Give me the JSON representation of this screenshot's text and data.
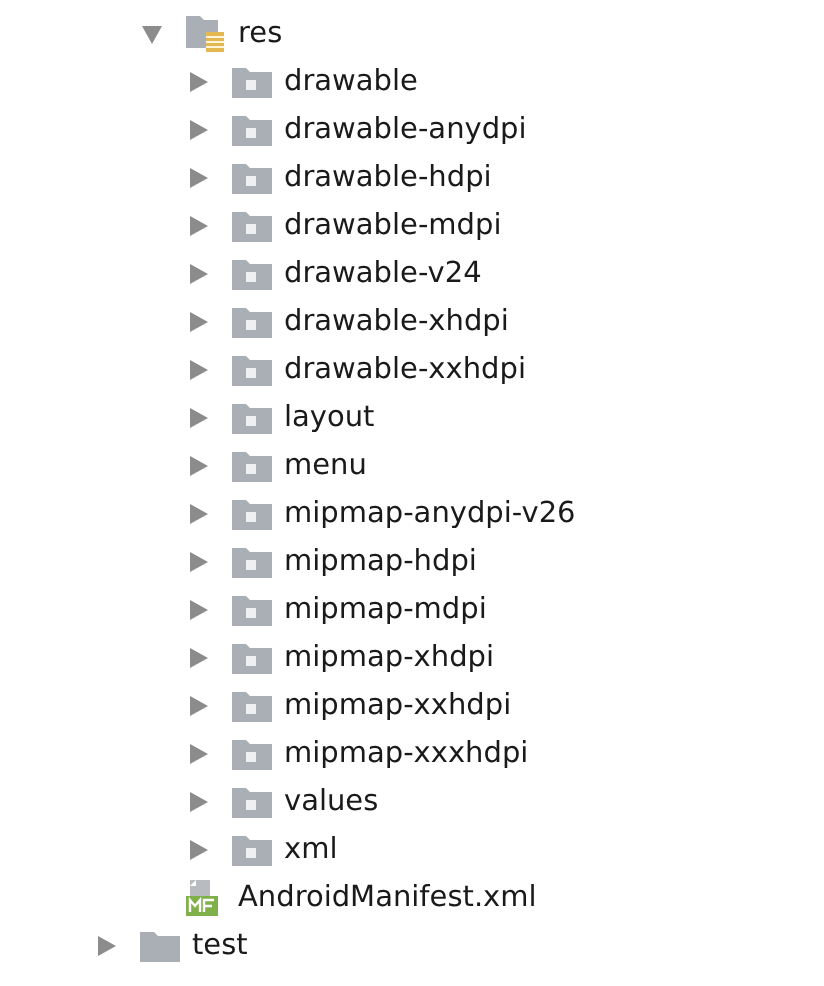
{
  "tree": {
    "children": [
      {
        "label": "res",
        "kind": "resource-folder",
        "expanded": true,
        "children": [
          {
            "label": "drawable",
            "kind": "folder",
            "expanded": false
          },
          {
            "label": "drawable-anydpi",
            "kind": "folder",
            "expanded": false
          },
          {
            "label": "drawable-hdpi",
            "kind": "folder",
            "expanded": false
          },
          {
            "label": "drawable-mdpi",
            "kind": "folder",
            "expanded": false
          },
          {
            "label": "drawable-v24",
            "kind": "folder",
            "expanded": false
          },
          {
            "label": "drawable-xhdpi",
            "kind": "folder",
            "expanded": false
          },
          {
            "label": "drawable-xxhdpi",
            "kind": "folder",
            "expanded": false
          },
          {
            "label": "layout",
            "kind": "folder",
            "expanded": false
          },
          {
            "label": "menu",
            "kind": "folder",
            "expanded": false
          },
          {
            "label": "mipmap-anydpi-v26",
            "kind": "folder",
            "expanded": false
          },
          {
            "label": "mipmap-hdpi",
            "kind": "folder",
            "expanded": false
          },
          {
            "label": "mipmap-mdpi",
            "kind": "folder",
            "expanded": false
          },
          {
            "label": "mipmap-xhdpi",
            "kind": "folder",
            "expanded": false
          },
          {
            "label": "mipmap-xxhdpi",
            "kind": "folder",
            "expanded": false
          },
          {
            "label": "mipmap-xxxhdpi",
            "kind": "folder",
            "expanded": false
          },
          {
            "label": "values",
            "kind": "folder",
            "expanded": false
          },
          {
            "label": "xml",
            "kind": "folder",
            "expanded": false
          }
        ]
      },
      {
        "label": "AndroidManifest.xml",
        "kind": "manifest"
      }
    ]
  },
  "outer_items": [
    {
      "label": "test",
      "kind": "plain-folder",
      "expanded": false
    }
  ]
}
